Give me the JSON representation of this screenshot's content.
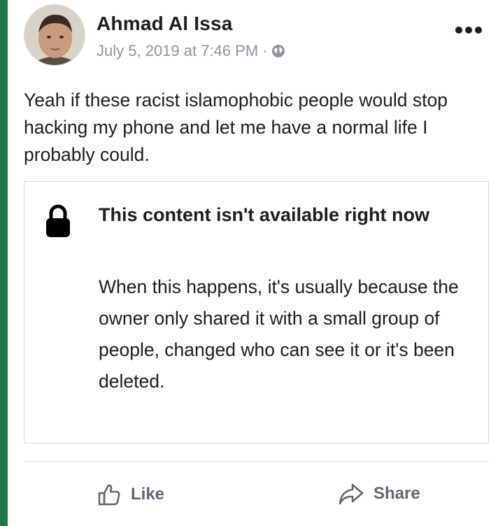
{
  "post": {
    "author": "Ahmad Al Issa",
    "timestamp": "July 5, 2019 at 7:46 PM",
    "separator": "·",
    "privacy_icon": "globe-icon",
    "text": "Yeah if these racist islamophobic people would stop hacking my phone and let me have a normal life I probably could."
  },
  "attachment": {
    "icon": "lock-icon",
    "title": "This content isn't available right now",
    "body": "When this happens, it's usually because the owner only shared it with a small group of people, changed who can see it or it's been deleted."
  },
  "actions": {
    "like_label": "Like",
    "share_label": "Share"
  },
  "colors": {
    "accent_bar": "#1e7a49",
    "text": "#1c1e21",
    "meta": "#8d949e",
    "action": "#606770"
  }
}
